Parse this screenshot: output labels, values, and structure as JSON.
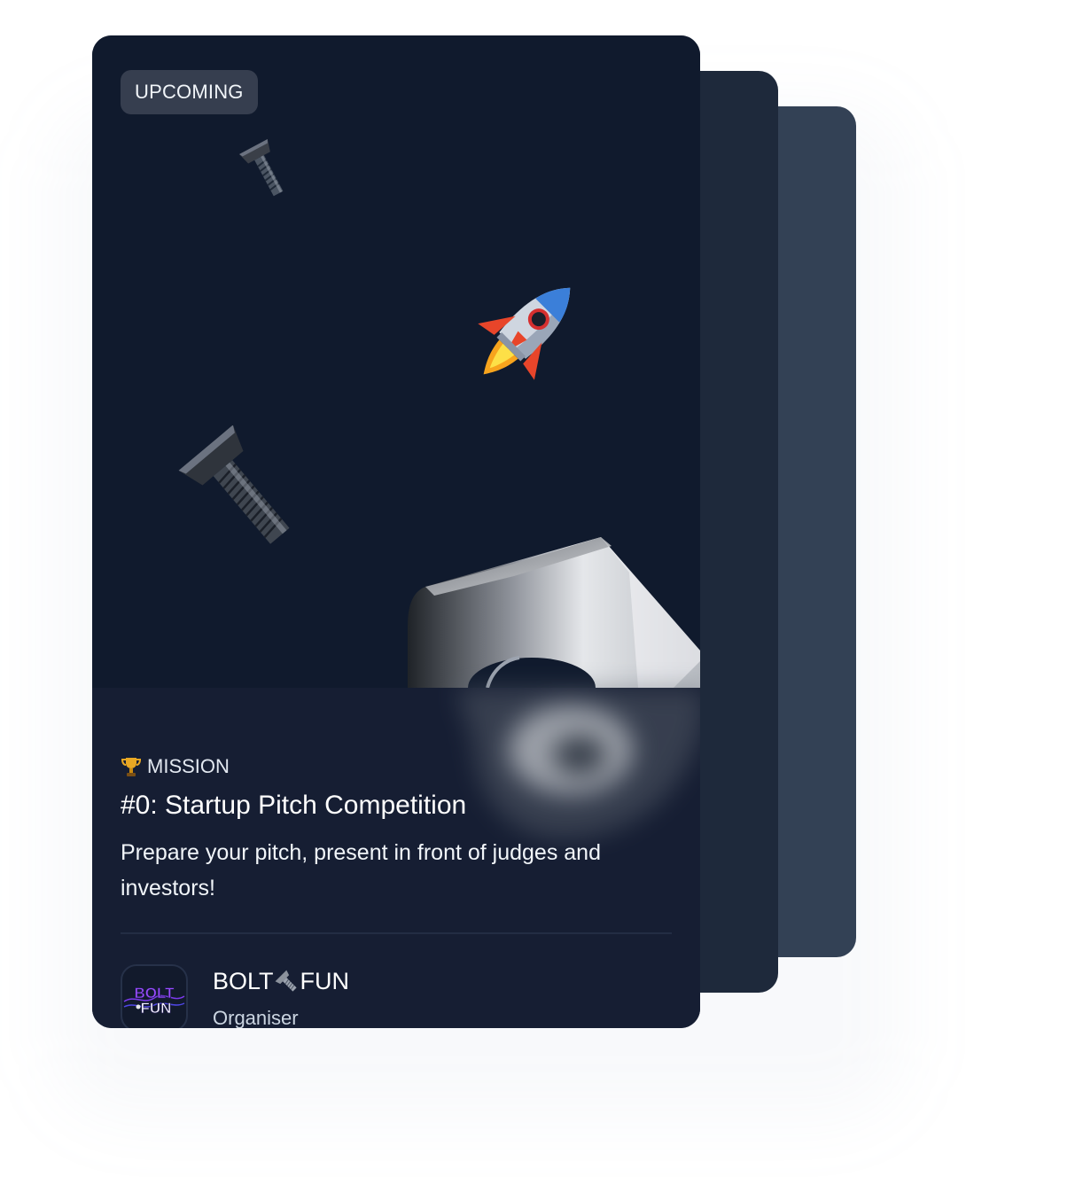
{
  "event": {
    "status_badge": "UPCOMING",
    "category_label": "MISSION",
    "category_icon": "trophy-icon",
    "title": "#0: Startup Pitch Competition",
    "description": "Prepare your pitch, present in front of judges and investors!"
  },
  "organiser": {
    "name_part_1": "BOLT",
    "name_part_2": "FUN",
    "name_separator_icon": "bolt-icon",
    "role": "Organiser",
    "logo_icon": "boltfun-logo-icon",
    "logo_text_top": "BOLT",
    "logo_text_bottom": "FUN"
  },
  "colors": {
    "card_background": "#111a2e",
    "card_back_1": "#1e293b",
    "card_back_2": "#334155",
    "badge_background": "#363e4f",
    "logo_purple": "#9b4dff"
  },
  "decorations": [
    "small-bolt-icon",
    "rocket-icon",
    "large-bolt-icon",
    "nut-icon"
  ]
}
